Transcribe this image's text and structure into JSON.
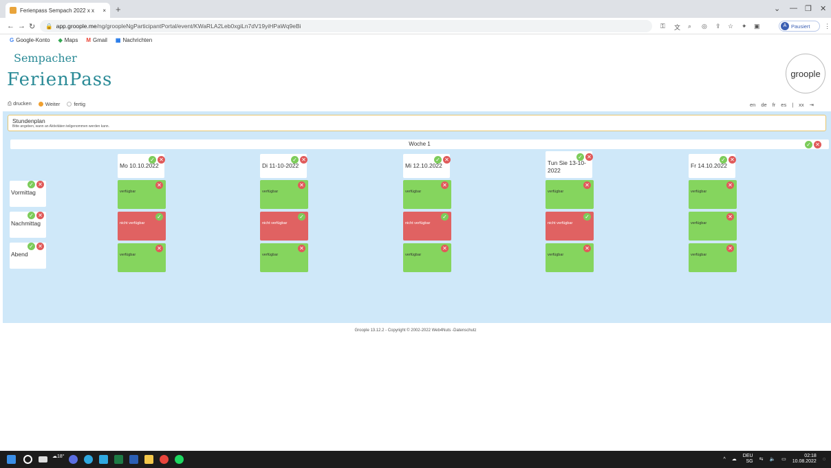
{
  "browser": {
    "tab_title": "Ferienpass Sempach 2022 x x",
    "url_host": "app.groople.me",
    "url_path": "/ng/groopleNgParticipantPortal/event/KWaRLA2Leb0xgiLn7dV19yiHPaWq9eBi",
    "profile_initial": "A",
    "profile_status": "Pausiert",
    "bookmarks": [
      {
        "label": "Google-Konto",
        "icon": "google-icon"
      },
      {
        "label": "Maps",
        "icon": "maps-icon"
      },
      {
        "label": "Gmail",
        "icon": "gmail-icon"
      },
      {
        "label": "Nachrichten",
        "icon": "news-icon"
      }
    ]
  },
  "header": {
    "logo_line1": "Sempacher",
    "logo_line2": "FerienPass",
    "brand": "groople",
    "actions": [
      "drucken",
      "Weiter",
      "fertig"
    ],
    "languages": [
      "en",
      "de",
      "fr",
      "es",
      "|",
      "xx"
    ]
  },
  "schedule": {
    "title": "Stundenplan",
    "subtitle": "Bitte angeben, wann an Aktivitäten teilgenommen werden kann.",
    "week_label": "Woche 1",
    "days": [
      "Mo 10.10.2022",
      "Di 11-10-2022",
      "Mi 12.10.2022",
      "Tun Sie 13-10-2022",
      "Fr 14.10.2022"
    ],
    "slots": [
      "Vormittag",
      "Nachmittag",
      "Abend"
    ],
    "status_available": "verfügbar",
    "status_unavailable": "nicht verfügbar",
    "grid": [
      [
        "verfügbar",
        "verfügbar",
        "verfügbar",
        "verfügbar",
        "verfügbar"
      ],
      [
        "nicht verfügbar",
        "nicht verfügbar",
        "nicht verfügbar",
        "nicht verfügbar",
        "verfügbar"
      ],
      [
        "verfügbar",
        "verfügbar",
        "verfügbar",
        "verfügbar",
        "verfügbar"
      ]
    ]
  },
  "footer": {
    "text": "Groople 13.12.2 - Copyright © 2002-2022 Web4Nuts -Datenschutz"
  },
  "taskbar": {
    "weather": "18°",
    "lang": "DEU",
    "lang_sub": "SG",
    "time": "02:18",
    "date": "10.08.2022"
  },
  "colors": {
    "available": "#85d55e",
    "unavailable": "#e06262",
    "background": "#cfe8f9"
  }
}
